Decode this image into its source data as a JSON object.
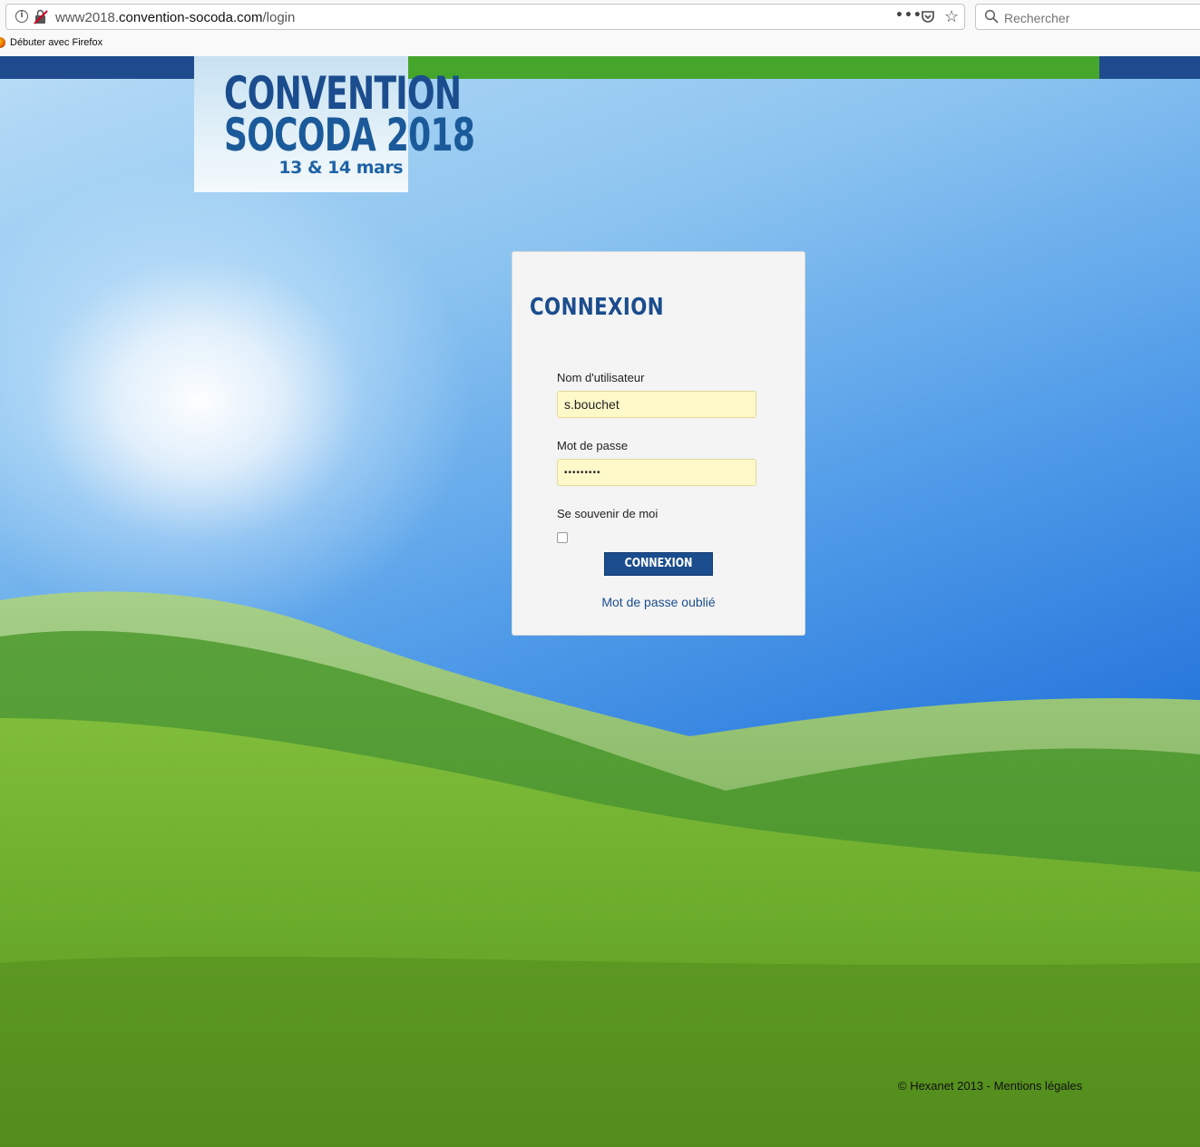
{
  "browser": {
    "url_prefix": "www2018.",
    "url_host": "convention-socoda.com",
    "url_path": "/login",
    "search_placeholder": "Rechercher",
    "bookmark_label": "Débuter avec Firefox"
  },
  "logo": {
    "line1": "CONVENTION",
    "line2": "SOCODA 2018",
    "date": "13 & 14 mars"
  },
  "login": {
    "title": "CONNEXION",
    "username_label": "Nom d'utilisateur",
    "username_value": "s.bouchet",
    "password_label": "Mot de passe",
    "password_value": "•••••••••",
    "remember_label": "Se souvenir de moi",
    "remember_checked": false,
    "submit_label": "CONNEXION",
    "forgot_label": "Mot de passe oublié"
  },
  "footer": {
    "text": "© Hexanet 2013 - Mentions légales"
  },
  "colors": {
    "brand_blue": "#1b4d8e",
    "bar_green": "#46a62c",
    "autofill_yellow": "#fff8c9"
  }
}
